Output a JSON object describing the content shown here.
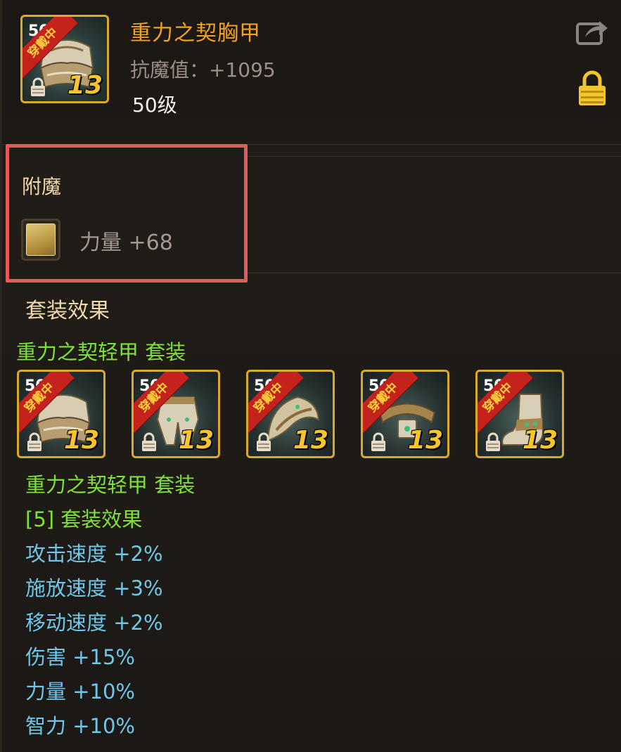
{
  "item": {
    "name": "重力之契胸甲",
    "stat": "抗魔值：+1095",
    "level": "50级",
    "icon": {
      "badge": "50级",
      "ribbon": "穿戴中",
      "plus": "13"
    }
  },
  "enchant": {
    "title": "附魔",
    "value": "力量 +68"
  },
  "set": {
    "title": "套装效果",
    "name": "重力之契轻甲 套装",
    "pieces": [
      {
        "badge": "50级",
        "ribbon": "穿戴中",
        "plus": "13"
      },
      {
        "badge": "50级",
        "ribbon": "穿戴中",
        "plus": "13"
      },
      {
        "badge": "50级",
        "ribbon": "穿戴中",
        "plus": "13"
      },
      {
        "badge": "50级",
        "ribbon": "穿戴中",
        "plus": "13"
      },
      {
        "badge": "50级",
        "ribbon": "穿戴中",
        "plus": "13"
      }
    ],
    "effect_name": "重力之契轻甲 套装",
    "effect_count": "[5] 套装效果",
    "bonuses": [
      "攻击速度 +2%",
      "施放速度 +3%",
      "移动速度 +2%",
      "伤害 +15%",
      "力量 +10%",
      "智力 +10%"
    ]
  },
  "icons": {
    "share": "share-icon",
    "lock": "lock-icon"
  },
  "colors": {
    "item_name": "#f2a21f",
    "set_green": "#7fe03c",
    "bonus_blue": "#6fc6e6",
    "frame_gold": "#d9a92b",
    "highlight_red": "#e35a5a"
  }
}
